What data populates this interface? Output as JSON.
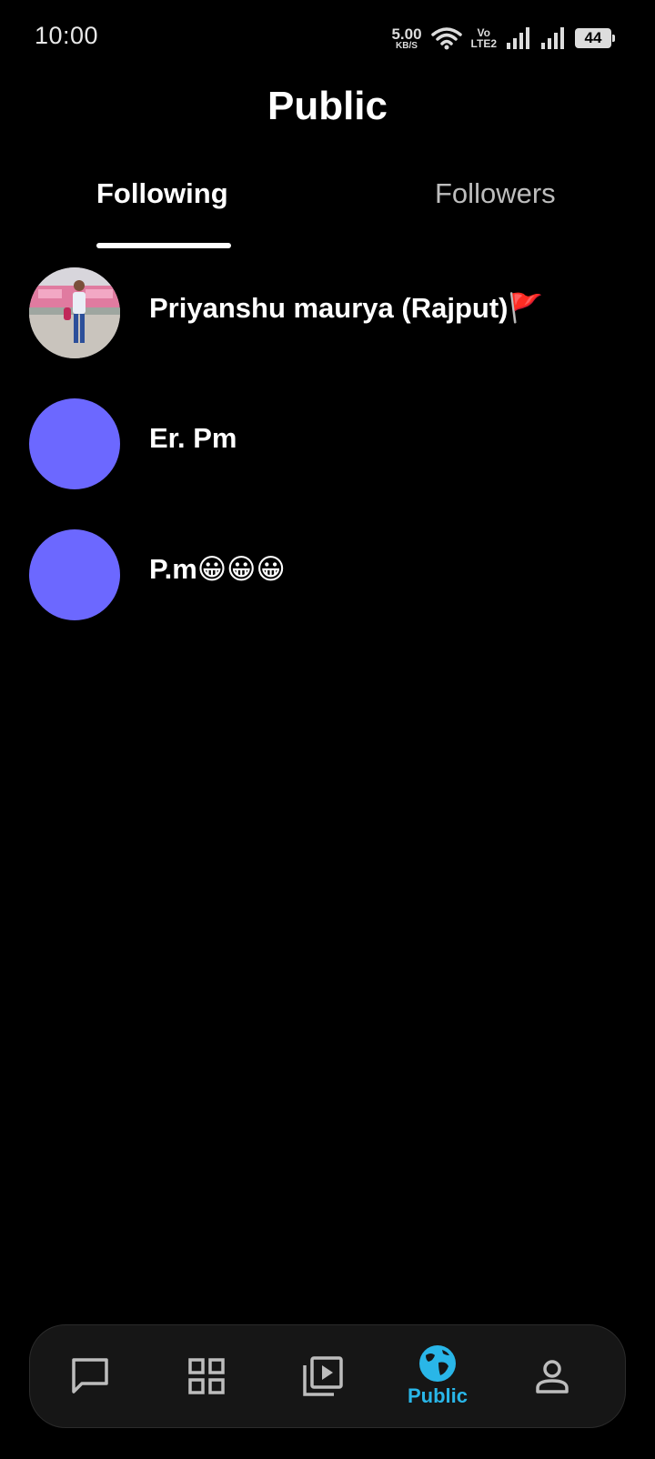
{
  "status_bar": {
    "time": "10:00",
    "net_speed_value": "5.00",
    "net_speed_unit": "KB/S",
    "volte_top": "Vo",
    "volte_bottom": "LTE2",
    "battery_level": "44",
    "icons": [
      "wifi-icon",
      "signal-icon",
      "signal-icon",
      "battery-icon"
    ]
  },
  "header": {
    "title": "Public"
  },
  "tabs": [
    {
      "label": "Following",
      "active": true
    },
    {
      "label": "Followers",
      "active": false
    }
  ],
  "following": [
    {
      "name": "Priyanshu maurya (Rajput)🚩",
      "avatar": "photo"
    },
    {
      "name": "Er. Pm",
      "avatar": "placeholder"
    },
    {
      "name": "P.m😀😀😀",
      "avatar": "placeholder"
    }
  ],
  "bottom_nav": {
    "items": [
      {
        "icon": "chat-icon"
      },
      {
        "icon": "grid-icon"
      },
      {
        "icon": "video-library-icon"
      },
      {
        "icon": "globe-icon",
        "label": "Public",
        "active": true
      },
      {
        "icon": "person-icon"
      }
    ]
  },
  "colors": {
    "background": "#000000",
    "avatar_placeholder": "#6c68ff",
    "accent": "#29b6e8",
    "nav_background": "#161616"
  }
}
